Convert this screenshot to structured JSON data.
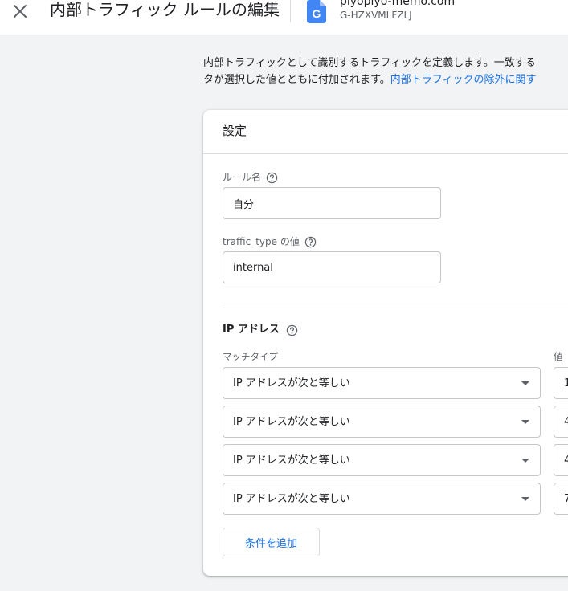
{
  "header": {
    "close_icon": "close-icon",
    "title": "内部トラフィック ルールの編集",
    "property_icon": "google-analytics-property-icon",
    "property_name": "piyopiyo-memo.com",
    "property_id": "G-HZXVMLFZLJ"
  },
  "description": {
    "line1": "内部トラフィックとして識別するトラフィックを定義します。一致する",
    "line2": "タが選択した値とともに付加されます。",
    "link": "内部トラフィックの除外に関す"
  },
  "card": {
    "title": "設定",
    "rule_name": {
      "label": "ルール名",
      "value": "自分",
      "help_icon": "help-icon"
    },
    "traffic_type": {
      "label": "traffic_type の値",
      "value": "internal",
      "help_icon": "help-icon"
    },
    "ip_section": {
      "title": "IP アドレス",
      "help_icon": "help-icon",
      "match_type_label": "マッチタイプ",
      "value_label": "値",
      "conditions": [
        {
          "match_type": "IP アドレスが次と等しい",
          "value": "1"
        },
        {
          "match_type": "IP アドレスが次と等しい",
          "value": "4"
        },
        {
          "match_type": "IP アドレスが次と等しい",
          "value": "4"
        },
        {
          "match_type": "IP アドレスが次と等しい",
          "value": "7"
        }
      ],
      "add_button": "条件を追加"
    }
  },
  "colors": {
    "accent": "#1a73e8",
    "background": "#f1f3f4",
    "text": "#202124",
    "secondary_text": "#5f6368"
  }
}
